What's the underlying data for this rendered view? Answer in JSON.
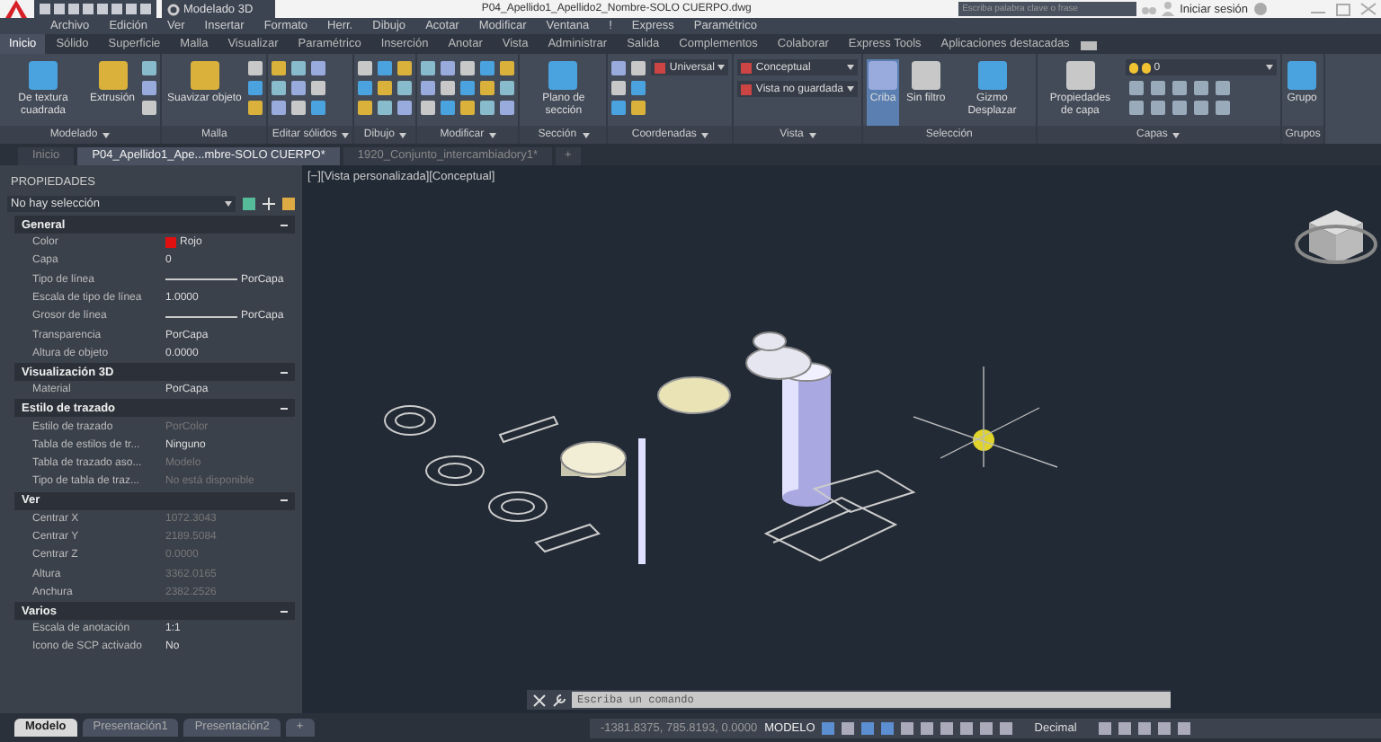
{
  "title_bar": {
    "workspace": "Modelado 3D",
    "title": "P04_Apellido1_Apellido2_Nombre-SOLO CUERPO.dwg",
    "search_placeholder": "Escriba palabra clave o frase",
    "user": "Iniciar sesión"
  },
  "menu_bar": [
    "Archivo",
    "Edición",
    "Ver",
    "Insertar",
    "Formato",
    "Herr.",
    "Dibujo",
    "Acotar",
    "Modificar",
    "Ventana",
    "!",
    "Express",
    "Paramétrico"
  ],
  "ribbon_tabs": [
    {
      "label": "Inicio",
      "selected": true
    },
    {
      "label": "Sólido",
      "selected": false
    },
    {
      "label": "Superficie",
      "selected": false
    },
    {
      "label": "Malla",
      "selected": false
    },
    {
      "label": "Visualizar",
      "selected": false
    },
    {
      "label": "Paramétrico",
      "selected": false
    },
    {
      "label": "Inserción",
      "selected": false
    },
    {
      "label": "Anotar",
      "selected": false
    },
    {
      "label": "Vista",
      "selected": false
    },
    {
      "label": "Administrar",
      "selected": false
    },
    {
      "label": "Salida",
      "selected": false
    },
    {
      "label": "Complementos",
      "selected": false
    },
    {
      "label": "Colaborar",
      "selected": false
    },
    {
      "label": "Express Tools",
      "selected": false
    },
    {
      "label": "Aplicaciones destacadas",
      "selected": false
    }
  ],
  "ribbon_panels": [
    {
      "title": "Modelado",
      "menu": true,
      "items": [
        {
          "kind": "large",
          "label": "De textura cuadrada",
          "selected": false
        },
        {
          "kind": "large",
          "label": "Extrusión",
          "selected": false
        },
        {
          "kind": "tool_column"
        }
      ]
    },
    {
      "title": "Malla",
      "menu": false,
      "items": [
        {
          "kind": "large",
          "label": "Suavizar objeto",
          "selected": false
        },
        {
          "kind": "tool_column"
        }
      ]
    },
    {
      "title": "Editar sólidos",
      "menu": true,
      "items": [
        {
          "kind": "tool_column"
        },
        {
          "kind": "tool_column"
        },
        {
          "kind": "tool_column"
        }
      ]
    },
    {
      "title": "Dibujo",
      "menu": true,
      "items": [
        {
          "kind": "tool_column"
        },
        {
          "kind": "tool_column"
        },
        {
          "kind": "tool_column"
        }
      ]
    },
    {
      "title": "Modificar",
      "menu": true,
      "items": [
        {
          "kind": "tool_column"
        },
        {
          "kind": "tool_column"
        },
        {
          "kind": "tool_column"
        },
        {
          "kind": "tool_column"
        },
        {
          "kind": "tool_column"
        }
      ]
    },
    {
      "title": "Sección",
      "menu": true,
      "items": [
        {
          "kind": "large",
          "label": "Plano de sección",
          "selected": false
        }
      ]
    },
    {
      "title": "Coordenadas",
      "menu": true,
      "items": [
        {
          "kind": "tool_column"
        },
        {
          "kind": "tool_column"
        },
        {
          "kind": "dropdowns",
          "labels": [
            "Universal"
          ]
        }
      ]
    },
    {
      "title": "Vista",
      "menu": true,
      "items": [
        {
          "kind": "dropdowns",
          "labels": [
            "Conceptual",
            "Vista no guardada"
          ]
        }
      ]
    },
    {
      "title": "Selección",
      "menu": false,
      "items": [
        {
          "kind": "large",
          "label": "Criba",
          "selected": true
        },
        {
          "kind": "large",
          "label": "Sin filtro",
          "selected": false
        },
        {
          "kind": "large",
          "label": "Gizmo Desplazar",
          "selected": false
        }
      ]
    },
    {
      "title": "Capas",
      "menu": true,
      "items": [
        {
          "kind": "large",
          "label": "Propiedades de capa",
          "selected": false
        },
        {
          "kind": "layers",
          "label": "0"
        }
      ]
    },
    {
      "title": "Grupos",
      "menu": false,
      "items": [
        {
          "kind": "large",
          "label": "Grupo",
          "selected": false
        }
      ]
    }
  ],
  "document_tabs": [
    {
      "label": "Inicio",
      "selected": false
    },
    {
      "label": "P04_Apellido1_Ape...mbre-SOLO CUERPO*",
      "selected": true
    },
    {
      "label": "1920_Conjunto_intercambiadory1*",
      "selected": false
    }
  ],
  "new_tab": "+",
  "properties": {
    "title": "PROPIEDADES",
    "selection": "No hay selección",
    "sections": [
      {
        "title": "General",
        "expanded": true,
        "rows": [
          {
            "kind": "swatch",
            "label": "Color",
            "value": "Rojo",
            "color": "#e01010"
          },
          {
            "kind": "text",
            "label": "Capa",
            "value": "0",
            "disabled": false
          },
          {
            "kind": "line",
            "label": "Tipo de línea",
            "value": "PorCapa"
          },
          {
            "kind": "text",
            "label": "Escala de tipo de línea",
            "value": "1.0000",
            "disabled": false
          },
          {
            "kind": "line",
            "label": "Grosor de línea",
            "value": "PorCapa"
          },
          {
            "kind": "text",
            "label": "Transparencia",
            "value": "PorCapa",
            "disabled": false
          },
          {
            "kind": "text",
            "label": "Altura de objeto",
            "value": "0.0000",
            "disabled": false
          }
        ]
      },
      {
        "title": "Visualización 3D",
        "expanded": true,
        "rows": [
          {
            "kind": "text",
            "label": "Material",
            "value": "PorCapa",
            "disabled": false
          }
        ]
      },
      {
        "title": "Estilo de trazado",
        "expanded": true,
        "rows": [
          {
            "kind": "text",
            "label": "Estilo de trazado",
            "value": "PorColor",
            "disabled": true
          },
          {
            "kind": "text",
            "label": "Tabla de estilos de tr...",
            "value": "Ninguno",
            "disabled": false
          },
          {
            "kind": "text",
            "label": "Tabla de trazado aso...",
            "value": "Modelo",
            "disabled": true
          },
          {
            "kind": "text",
            "label": "Tipo de tabla de traz...",
            "value": "No está disponible",
            "disabled": true
          }
        ]
      },
      {
        "title": "Ver",
        "expanded": true,
        "rows": [
          {
            "kind": "text",
            "label": "Centrar X",
            "value": "1072.3043",
            "disabled": true
          },
          {
            "kind": "text",
            "label": "Centrar Y",
            "value": "2189.5084",
            "disabled": true
          },
          {
            "kind": "text",
            "label": "Centrar Z",
            "value": "0.0000",
            "disabled": true
          },
          {
            "kind": "text",
            "label": "Altura",
            "value": "3362.0165",
            "disabled": true
          },
          {
            "kind": "text",
            "label": "Anchura",
            "value": "2382.2526",
            "disabled": true
          }
        ]
      },
      {
        "title": "Varios",
        "expanded": true,
        "rows": [
          {
            "kind": "text",
            "label": "Escala de anotación",
            "value": "1:1",
            "disabled": false
          },
          {
            "kind": "text",
            "label": "Icono de SCP activado",
            "value": "No",
            "disabled": false
          }
        ]
      }
    ]
  },
  "viewport": {
    "label": "[−][Vista personalizada][Conceptual]"
  },
  "command_line": {
    "placeholder": "Escriba un comando"
  },
  "layout_tabs": [
    {
      "label": "Modelo",
      "selected": true
    },
    {
      "label": "Presentación1",
      "selected": false
    },
    {
      "label": "Presentación2",
      "selected": false
    }
  ],
  "new_layout": "+",
  "status_bar": {
    "coordinates": "-1381.8375, 785.8193, 0.0000",
    "space": "MODELO",
    "units": "Decimal"
  }
}
